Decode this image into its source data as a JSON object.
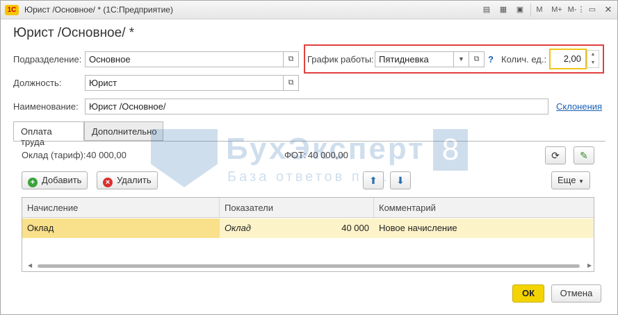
{
  "window": {
    "title": "Юрист /Основное/ * (1С:Предприятие)",
    "app_logo": "1С",
    "toolbar_icons": [
      "document-icon",
      "table-icon",
      "calendar-icon"
    ],
    "memory_buttons": [
      "M",
      "M+",
      "M-"
    ],
    "controls": [
      "minimize",
      "maximize",
      "close"
    ]
  },
  "form": {
    "title": "Юрист /Основное/ *",
    "subdivision_label": "Подразделение:",
    "subdivision_value": "Основное",
    "position_label": "Должность:",
    "position_value": "Юрист",
    "name_label": "Наименование:",
    "name_value": "Юрист /Основное/",
    "declensions_link": "Склонения",
    "schedule_label": "График работы:",
    "schedule_value": "Пятидневка",
    "help": "?",
    "qty_label": "Колич. ед.:",
    "qty_value": "2,00"
  },
  "tabs": [
    {
      "label": "Оплата труда",
      "active": true
    },
    {
      "label": "Дополнительно",
      "active": false
    }
  ],
  "pay": {
    "salary_label": "Оклад (тариф):",
    "salary_value": "40 000,00",
    "fot_label": "ФОТ:",
    "fot_value": "40 000,00",
    "add_label": "Добавить",
    "delete_label": "Удалить",
    "more_label": "Еще"
  },
  "grid": {
    "headers": [
      "Начисление",
      "Показатели",
      "Комментарий"
    ],
    "rows": [
      {
        "accrual": "Оклад",
        "indicator": "Оклад",
        "amount": "40 000",
        "comment": "Новое начисление"
      }
    ]
  },
  "footer": {
    "ok_label": "ОК",
    "cancel_label": "Отмена"
  },
  "watermark": {
    "title": "БухЭксперт",
    "number": "8",
    "subtitle": "База ответов по 1С"
  }
}
